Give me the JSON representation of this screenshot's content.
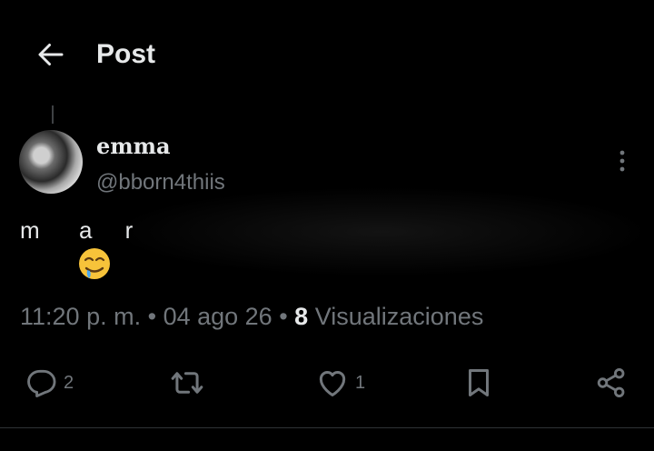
{
  "header": {
    "title": "Post"
  },
  "post": {
    "author_name": "emma",
    "author_handle": "@bborn4thiis",
    "text": "m      a     r",
    "emoji": "drooling-face",
    "time": "11:20 p. m.",
    "separator": "•",
    "date": "04 ago 26",
    "views_count": "8",
    "views_label": "Visualizaciones"
  },
  "actions": {
    "reply_count": "2",
    "like_count": "1"
  },
  "icons": [
    "back-arrow-icon",
    "more-vertical-icon",
    "reply-icon",
    "repost-icon",
    "like-icon",
    "bookmark-icon",
    "share-icon"
  ],
  "colors": {
    "background": "#000000",
    "primary_text": "#e7e9ea",
    "secondary_text": "#71767b"
  }
}
